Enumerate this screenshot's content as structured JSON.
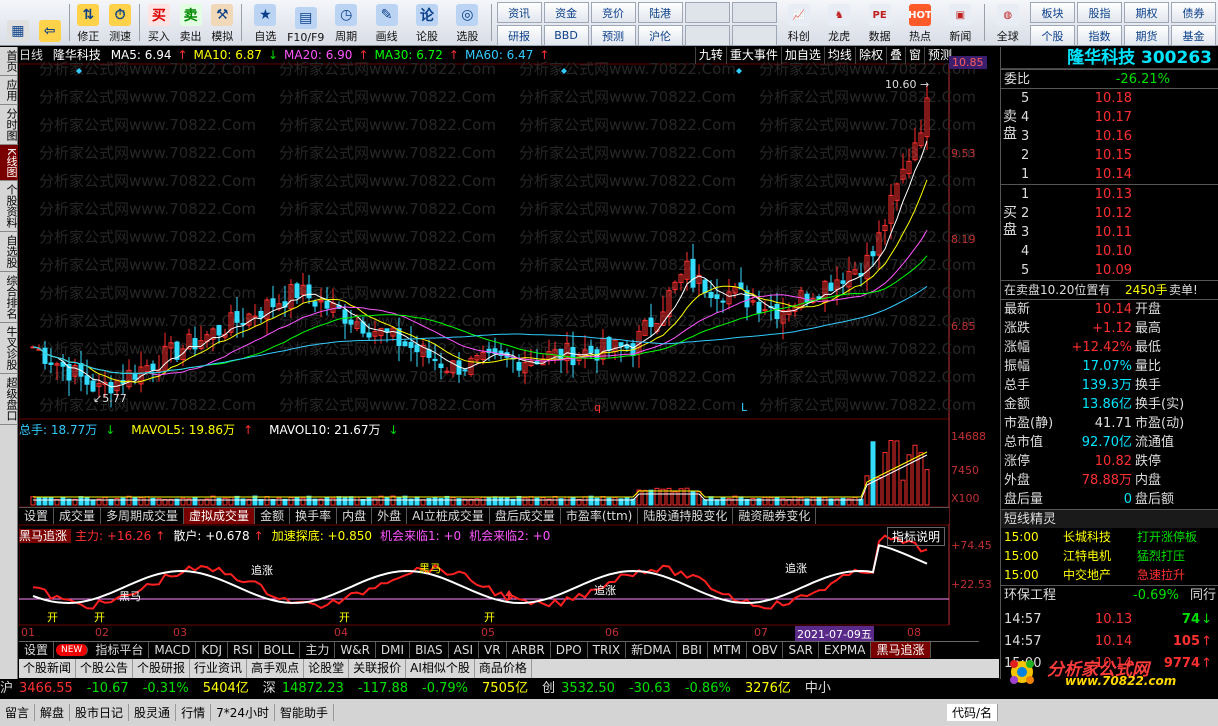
{
  "toolbar": {
    "buttons": [
      {
        "label": "",
        "icon": "grid-menu-icon"
      },
      {
        "label": "",
        "icon": "back-arrow-icon"
      },
      {
        "label": "修正",
        "icon": "updown-arrows-icon"
      },
      {
        "label": "测速",
        "icon": "stopwatch-icon"
      },
      {
        "label": "买入",
        "icon": "buy-icon"
      },
      {
        "label": "卖出",
        "icon": "sell-icon"
      },
      {
        "label": "模拟",
        "icon": "gavel-icon"
      },
      {
        "label": "自选",
        "icon": "star-icon"
      },
      {
        "label": "F10/F9",
        "icon": "f10-icon"
      },
      {
        "label": "周期",
        "icon": "clock-icon"
      },
      {
        "label": "画线",
        "icon": "pencil-icon"
      },
      {
        "label": "论股",
        "icon": "discuss-icon"
      },
      {
        "label": "选股",
        "icon": "search-chart-icon"
      }
    ],
    "grid1": [
      "资讯",
      "资金",
      "竞价",
      "陆港",
      "",
      "",
      "研报",
      "BBD",
      "预测",
      "沪伦",
      "",
      ""
    ],
    "icons_mid": [
      {
        "label": "科创",
        "icon": "chart-icon"
      },
      {
        "label": "龙虎",
        "icon": "bull-icon"
      },
      {
        "label": "数据",
        "icon": "pe-icon"
      },
      {
        "label": "热点",
        "icon": "hot-icon"
      },
      {
        "label": "新闻",
        "icon": "news-icon"
      },
      {
        "label": "全球",
        "icon": "globe-icon"
      }
    ],
    "grid2": [
      "板块",
      "股指",
      "期权",
      "债券",
      "个股",
      "指数",
      "期货",
      "基金"
    ]
  },
  "left_tabs": [
    "首页",
    "应用",
    "分时图",
    "K线图",
    "个股资料",
    "自选股",
    "综合排名",
    "牛叉诊股",
    "超级盘口"
  ],
  "active_left_tab": 3,
  "chart": {
    "period": "日线",
    "stock_name": "隆华科技",
    "ma": [
      {
        "label": "MA5: 6.94",
        "arrow": "↑",
        "color": "#ffffff"
      },
      {
        "label": "MA10: 6.87",
        "arrow": "↓",
        "color": "#ffff00"
      },
      {
        "label": "MA20: 6.90",
        "arrow": "↑",
        "color": "#ff55ff"
      },
      {
        "label": "MA30: 6.72",
        "arrow": "↑",
        "color": "#00ff00"
      },
      {
        "label": "MA60: 6.47",
        "arrow": "↑",
        "color": "#33ccff"
      }
    ],
    "menu": [
      "九转",
      "重大事件",
      "加自选",
      "均线",
      "除权",
      "叠",
      "窗",
      "预测"
    ],
    "price_axis": [
      "10.85",
      "9.53",
      "8.19",
      "6.85"
    ],
    "high_label": "10.60",
    "low_label": "5.77",
    "volume": [
      {
        "label": "总手: 18.77万",
        "arrow": "↓",
        "color": "#33ccff"
      },
      {
        "label": "MAVOL5: 19.86万",
        "arrow": "↑",
        "color": "#ffff00"
      },
      {
        "label": "MAVOL10: 21.67万",
        "arrow": "↓",
        "color": "#ffffff"
      }
    ],
    "vol_axis": [
      "14688",
      "7450",
      "X100"
    ],
    "indicator_tabs": [
      "设置",
      "成交量",
      "多周期成交量",
      "虚拟成交量",
      "金额",
      "换手率",
      "内盘",
      "外盘",
      "AI立桩成交量",
      "盘后成交量",
      "市盈率(ttm)",
      "陆股通持股变化",
      "融资融券变化"
    ],
    "active_indicator_tab": 3,
    "indicator": [
      {
        "label": "黑马追涨",
        "color": "#ffffff"
      },
      {
        "label": "主力: +16.26",
        "arrow": "↑",
        "color": "#ff3030"
      },
      {
        "label": "散户: +0.678",
        "arrow": "↑",
        "color": "#ffffff"
      },
      {
        "label": "加速探底: +0.850",
        "color": "#ffff00"
      },
      {
        "label": "机会来临1: +0",
        "color": "#ff55ff"
      },
      {
        "label": "机会来临2: +0",
        "color": "#ff55ff"
      }
    ],
    "indicator_button": "指标说明",
    "ind_axis": [
      "+74.45",
      "+22.53"
    ],
    "annotations": [
      "追涨",
      "黑马",
      "黑马",
      "追涨",
      "追涨"
    ],
    "date_labels": [
      "01",
      "02",
      "03",
      "04",
      "05",
      "06",
      "07",
      "08"
    ],
    "date_highlight": "2021-07-09五",
    "q_mark": "q",
    "l_mark": "L",
    "kai_mark": "开"
  },
  "bottom_indicator_tabs": [
    "设置",
    "NEW",
    "指标平台",
    "MACD",
    "KDJ",
    "RSI",
    "BOLL",
    "主力",
    "W&R",
    "DMI",
    "BIAS",
    "ASI",
    "VR",
    "ARBR",
    "DPO",
    "TRIX",
    "新DMA",
    "BBI",
    "MTM",
    "OBV",
    "SAR",
    "EXPMA",
    "黑马追涨"
  ],
  "news_tabs": [
    "个股新闻",
    "个股公告",
    "个股研报",
    "行业资讯",
    "高手观点",
    "论股堂",
    "关联报价",
    "AI相似个股",
    "商品价格"
  ],
  "index_bar": [
    {
      "text": "沪",
      "color": "#dddddd"
    },
    {
      "text": "3466.55",
      "color": "#ff3030"
    },
    {
      "text": "-10.67",
      "color": "#00e000"
    },
    {
      "text": "-0.31%",
      "color": "#00e000"
    },
    {
      "text": "5404亿",
      "color": "#ffff00"
    },
    {
      "text": "深",
      "color": "#dddddd"
    },
    {
      "text": "14872.23",
      "color": "#00e000"
    },
    {
      "text": "-117.88",
      "color": "#00e000"
    },
    {
      "text": "-0.79%",
      "color": "#00e000"
    },
    {
      "text": "7505亿",
      "color": "#ffff00"
    },
    {
      "text": "创",
      "color": "#dddddd"
    },
    {
      "text": "3532.50",
      "color": "#00e000"
    },
    {
      "text": "-30.63",
      "color": "#00e000"
    },
    {
      "text": "-0.86%",
      "color": "#00e000"
    },
    {
      "text": "3276亿",
      "color": "#ffff00"
    },
    {
      "text": "中小",
      "color": "#dddddd"
    }
  ],
  "status_bar": [
    "留言",
    "解盘",
    "股市日记",
    "股灵通",
    "行情",
    "7*24小时",
    "智能助手",
    "代码/名"
  ],
  "right": {
    "title": "隆华科技 300263",
    "weibi_label": "委比",
    "weibi_value": "-26.21%",
    "sell_label": "卖盘",
    "buy_label": "买盘",
    "sell": [
      {
        "n": "5",
        "p": "10.18"
      },
      {
        "n": "4",
        "p": "10.17"
      },
      {
        "n": "3",
        "p": "10.16"
      },
      {
        "n": "2",
        "p": "10.15"
      },
      {
        "n": "1",
        "p": "10.14"
      }
    ],
    "buy": [
      {
        "n": "1",
        "p": "10.13"
      },
      {
        "n": "2",
        "p": "10.12"
      },
      {
        "n": "3",
        "p": "10.11"
      },
      {
        "n": "4",
        "p": "10.10"
      },
      {
        "n": "5",
        "p": "10.09"
      }
    ],
    "notice": {
      "text": "在卖盘10.20位置有",
      "qty": "2450手",
      "tail": "卖单!"
    },
    "quote": [
      {
        "l1": "最新",
        "v1": "10.14",
        "c1": "#ff3030",
        "l2": "开盘",
        "v2": ""
      },
      {
        "l1": "涨跌",
        "v1": "+1.12",
        "c1": "#ff3030",
        "l2": "最高",
        "v2": ""
      },
      {
        "l1": "涨幅",
        "v1": "+12.42%",
        "c1": "#ff3030",
        "l2": "最低",
        "v2": ""
      },
      {
        "l1": "振幅",
        "v1": "17.07%",
        "c1": "#00e5ff",
        "l2": "量比",
        "v2": ""
      },
      {
        "l1": "总手",
        "v1": "139.3万",
        "c1": "#00e5ff",
        "l2": "换手",
        "v2": ""
      },
      {
        "l1": "金额",
        "v1": "13.86亿",
        "c1": "#00e5ff",
        "l2": "换手(实)",
        "v2": ""
      },
      {
        "l1": "市盈(静)",
        "v1": "41.71",
        "c1": "#dddddd",
        "l2": "市盈(动)",
        "v2": ""
      },
      {
        "l1": "总市值",
        "v1": "92.70亿",
        "c1": "#00e5ff",
        "l2": "流通值",
        "v2": ""
      },
      {
        "l1": "涨停",
        "v1": "10.82",
        "c1": "#ff3030",
        "l2": "跌停",
        "v2": ""
      },
      {
        "l1": "外盘",
        "v1": "78.88万",
        "c1": "#ff3030",
        "l2": "内盘",
        "v2": ""
      },
      {
        "l1": "盘后量",
        "v1": "0",
        "c1": "#00e5ff",
        "l2": "盘后额",
        "v2": ""
      }
    ],
    "elf_title": "短线精灵",
    "elf": [
      {
        "time": "15:00",
        "name": "长城科技",
        "event": "打开涨停板",
        "color": "#00e000"
      },
      {
        "time": "15:00",
        "name": "江特电机",
        "event": "猛烈打压",
        "color": "#00e000"
      },
      {
        "time": "15:00",
        "name": "中交地产",
        "event": "急速拉升",
        "color": "#ff3030"
      }
    ],
    "env": {
      "label": "环保工程",
      "value": "-0.69%",
      "tail": "同行"
    },
    "ticks": [
      {
        "time": "14:57",
        "price": "10.13",
        "vol": "74",
        "arrow": "↓",
        "color": "#00e000"
      },
      {
        "time": "14:57",
        "price": "10.14",
        "vol": "105",
        "arrow": "↑",
        "color": "#ff3030"
      },
      {
        "time": "15:00",
        "price": "10.14",
        "vol": "9774",
        "arrow": "↑",
        "color": "#ff3030"
      }
    ]
  },
  "logo": {
    "text": "分析家公式网",
    "url_text": "www.70822.com"
  },
  "watermark": "分析家公式网www.70822.Com"
}
